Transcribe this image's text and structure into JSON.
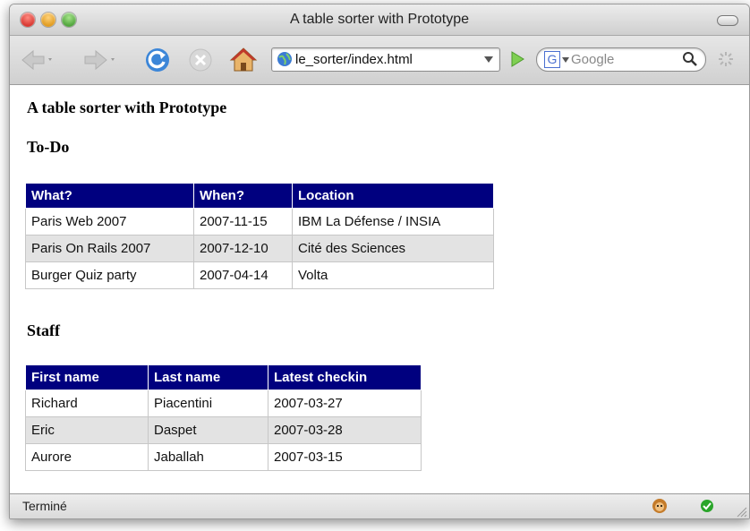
{
  "window": {
    "title": "A table sorter with Prototype",
    "traffic_colors": {
      "close": "#e0443e",
      "minimize": "#e8a328",
      "zoom": "#5fb34a"
    }
  },
  "toolbar": {
    "url": "le_sorter/index.html",
    "search_placeholder": "Google",
    "search_engine_letter": "G"
  },
  "page": {
    "heading": "A table sorter with Prototype",
    "todo": {
      "title": "To-Do",
      "columns": [
        "What?",
        "When?",
        "Location"
      ],
      "rows": [
        [
          "Paris Web 2007",
          "2007-11-15",
          "IBM La Défense / INSIA"
        ],
        [
          "Paris On Rails 2007",
          "2007-12-10",
          "Cité des Sciences"
        ],
        [
          "Burger Quiz party",
          "2007-04-14",
          "Volta"
        ]
      ]
    },
    "staff": {
      "title": "Staff",
      "columns": [
        "First name",
        "Last name",
        "Latest checkin"
      ],
      "rows": [
        [
          "Richard",
          "Piacentini",
          "2007-03-27"
        ],
        [
          "Eric",
          "Daspet",
          "2007-03-28"
        ],
        [
          "Aurore",
          "Jaballah",
          "2007-03-15"
        ]
      ]
    }
  },
  "statusbar": {
    "text": "Terminé"
  },
  "colors": {
    "table_header": "#00007f",
    "alt_row": "#e3e3e3"
  }
}
